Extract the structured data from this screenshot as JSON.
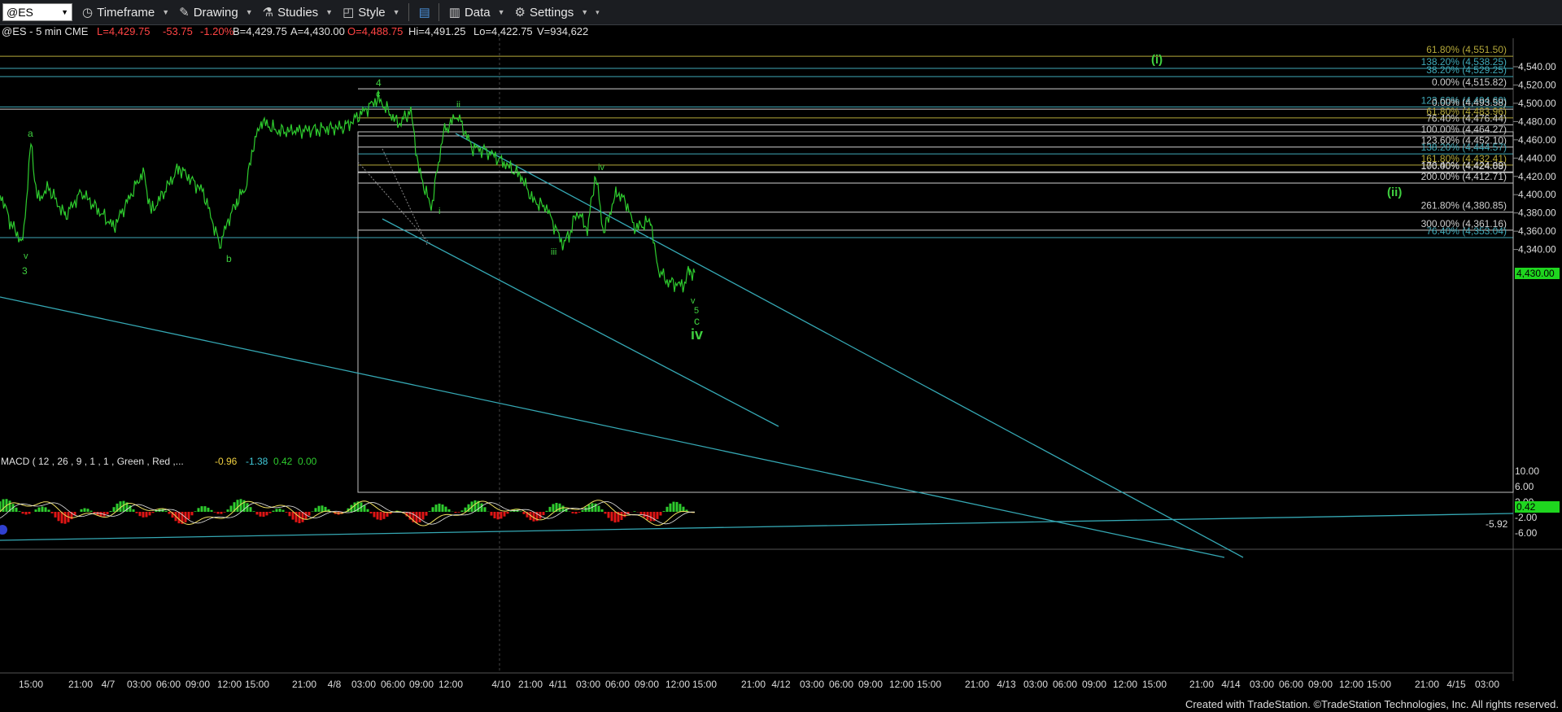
{
  "toolbar": {
    "symbol": "@ES",
    "timeframe": "Timeframe",
    "drawing": "Drawing",
    "studies": "Studies",
    "style": "Style",
    "data": "Data",
    "settings": "Settings"
  },
  "header": {
    "symbol_info": "@ES - 5 min  CME",
    "last": "L=4,429.75",
    "change": "-53.75",
    "pct": "-1.20%",
    "bid": "B=4,429.75",
    "ask": "A=4,430.00",
    "open": "O=4,488.75",
    "high": "Hi=4,491.25",
    "low": "Lo=4,422.75",
    "volume": "V=934,622"
  },
  "price_axis": {
    "ticks": [
      "4,540.00",
      "4,520.00",
      "4,500.00",
      "4,480.00",
      "4,460.00",
      "4,440.00",
      "4,420.00",
      "4,400.00",
      "4,380.00",
      "4,360.00",
      "4,340.00"
    ],
    "current_price": "4,430.00"
  },
  "macd": {
    "label": "MACD ( 12 , 26 , 9 , 1 , 1 , Green , Red ,...",
    "v1": "-0.96",
    "v2": "-1.38",
    "v3": "0.42",
    "v4": "0.00",
    "ticks": [
      "10.00",
      "6.00",
      "2.00",
      "-2.00",
      "-6.00"
    ],
    "current": "0.42",
    "line_value": "-5.92"
  },
  "time_axis": [
    "15:00",
    "21:00",
    "4/7",
    "03:00",
    "06:00",
    "09:00",
    "12:00",
    "15:00",
    "21:00",
    "4/8",
    "03:00",
    "06:00",
    "09:00",
    "12:00",
    "4/10",
    "21:00",
    "4/11",
    "03:00",
    "06:00",
    "09:00",
    "12:00",
    "15:00",
    "21:00",
    "4/12",
    "03:00",
    "06:00",
    "09:00",
    "12:00",
    "15:00",
    "21:00",
    "4/13",
    "03:00",
    "06:00",
    "09:00",
    "12:00",
    "15:00",
    "21:00",
    "4/14",
    "03:00",
    "06:00",
    "09:00",
    "12:00",
    "15:00",
    "21:00",
    "4/15",
    "03:00"
  ],
  "fib_levels": [
    {
      "label": "61.80% (4,551.50)",
      "price": 4551.5,
      "color": "#b5a93a"
    },
    {
      "label": "138.20% (4,538.25)",
      "price": 4538.25,
      "color": "#3fa9b8"
    },
    {
      "label": "38.20% (4,529.25)",
      "price": 4529.25,
      "color": "#3fa9b8"
    },
    {
      "label": "0.00% (4,515.82)",
      "price": 4515.82,
      "color": "#cfcfcf"
    },
    {
      "label": "123.60% (4,494.60)",
      "price": 4496.0,
      "color": "#3fa9b8"
    },
    {
      "label": "0.00% (4,493.58)",
      "price": 4493.58,
      "color": "#cfcfcf"
    },
    {
      "label": "61.80% (4,483.96)",
      "price": 4483.96,
      "color": "#b5a93a"
    },
    {
      "label": "76.40% (4,476.44)",
      "price": 4476.44,
      "color": "#cfcfcf"
    },
    {
      "label": "100.00% (4,464.27)",
      "price": 4464.27,
      "color": "#cfcfcf"
    },
    {
      "label": "123.60% (4,452.10)",
      "price": 4452.1,
      "color": "#cfcfcf"
    },
    {
      "label": "138.20% (4,444.57)",
      "price": 4444.57,
      "color": "#3fa9b8"
    },
    {
      "label": "161.80% (4,432.41)",
      "price": 4432.41,
      "color": "#b5a93a"
    },
    {
      "label": "176.40% (4,424.89)",
      "price": 4424.89,
      "color": "#cfcfcf"
    },
    {
      "label": "100.00% (4,424.08)",
      "price": 4424.08,
      "color": "#cfcfcf"
    },
    {
      "label": "200.00% (4,412.71)",
      "price": 4412.71,
      "color": "#cfcfcf"
    },
    {
      "label": "261.80% (4,380.85)",
      "price": 4380.85,
      "color": "#cfcfcf"
    },
    {
      "label": "300.00% (4,361.16)",
      "price": 4361.16,
      "color": "#cfcfcf"
    },
    {
      "label": "76.40% (4,353.04)",
      "price": 4353.04,
      "color": "#3fa9b8"
    }
  ],
  "wave_labels": {
    "a": "a",
    "v_left": "v",
    "three": "3",
    "b": "b",
    "four": "4",
    "c_top": "c",
    "i_small": "i",
    "ii_small": "ii",
    "iii_small": "iii",
    "iv_small": "iv",
    "v_small": "v",
    "five": "5",
    "c_main": "c",
    "iv_main": "iv",
    "i_paren": "(i)",
    "ii_paren": "(ii)"
  },
  "colors": {
    "price_line": "#2ecc2e",
    "channel": "#35a8b4",
    "fib_gold": "#b5a93a",
    "wave_label": "#3fcf3f"
  },
  "footer": "Created with TradeStation. ©TradeStation Technologies, Inc. All rights reserved."
}
